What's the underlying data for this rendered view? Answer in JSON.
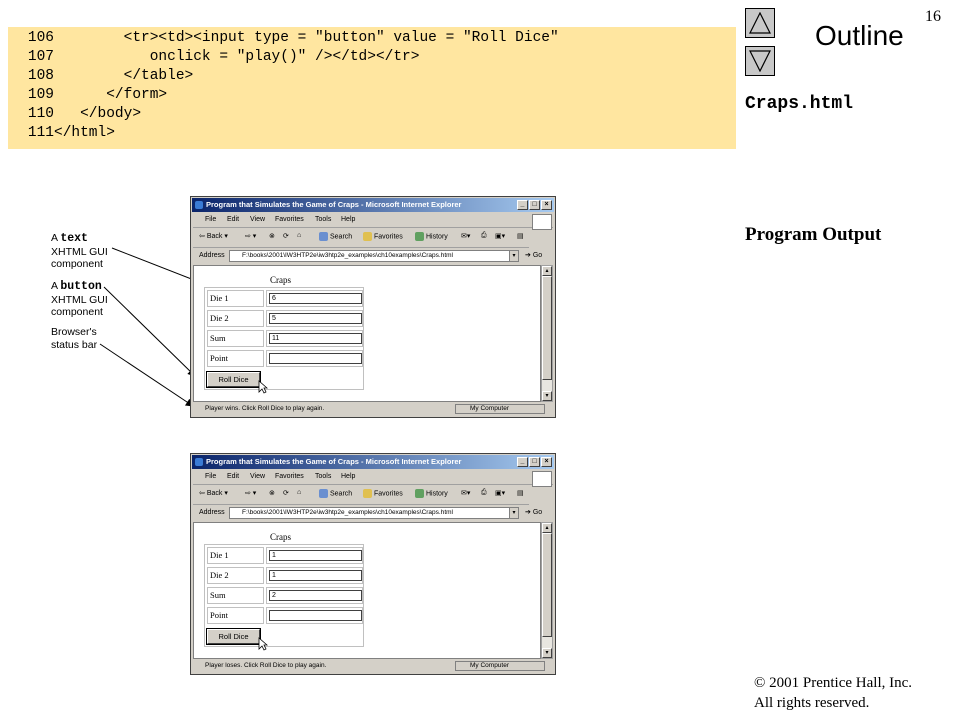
{
  "page_number": "16",
  "code_lines": [
    {
      "num": "106",
      "code": "        <tr><td><input type = \"button\" value = \"Roll Dice\""
    },
    {
      "num": "107",
      "code": "           onclick = \"play()\" /></td></tr>"
    },
    {
      "num": "108",
      "code": "        </table>"
    },
    {
      "num": "109",
      "code": "      </form>"
    },
    {
      "num": "110",
      "code": "   </body>"
    },
    {
      "num": "111",
      "code": "</html>"
    }
  ],
  "outline": {
    "title": "Outline",
    "file_title": "Craps.html",
    "program_output_label": "Program Output",
    "up_icon": "up-triangle-icon",
    "down_icon": "down-triangle-icon"
  },
  "annotations": [
    {
      "prefix": "A ",
      "mono": "text",
      "line2": "XHTML GUI",
      "line3": "component"
    },
    {
      "prefix": "A ",
      "mono": "button",
      "line2": "XHTML GUI",
      "line3": "component"
    },
    {
      "line1": "Browser's",
      "line2": "status bar"
    }
  ],
  "browser": {
    "window_title": "Program that Simulates the Game of Craps - Microsoft Internet Explorer",
    "menu": [
      "File",
      "Edit",
      "View",
      "Favorites",
      "Tools",
      "Help"
    ],
    "toolbar": {
      "back": "Back",
      "search": "Search",
      "favorites": "Favorites",
      "history": "History"
    },
    "address_label": "Address",
    "address": "F:\\books\\2001\\IW3HTP2e\\iw3htp2e_examples\\ch10examples\\Craps.html",
    "go_label": "Go",
    "zone": "My Computer",
    "heading": "Craps",
    "labels": [
      "Die 1",
      "Die 2",
      "Sum",
      "Point"
    ],
    "button_label": "Roll Dice"
  },
  "screens": [
    {
      "die1": "6",
      "die2": "5",
      "sum": "11",
      "point": "",
      "status": "Player wins. Click Roll Dice to play again."
    },
    {
      "die1": "1",
      "die2": "1",
      "sum": "2",
      "point": "",
      "status": "Player loses. Click Roll Dice to play again."
    }
  ],
  "copyright": {
    "line1": "© 2001 Prentice Hall, Inc.",
    "line2": "All rights reserved."
  },
  "colors": {
    "code_bg": "#ffe6a0",
    "titlebar": "#0a246a",
    "chrome": "#d4d0c8"
  }
}
